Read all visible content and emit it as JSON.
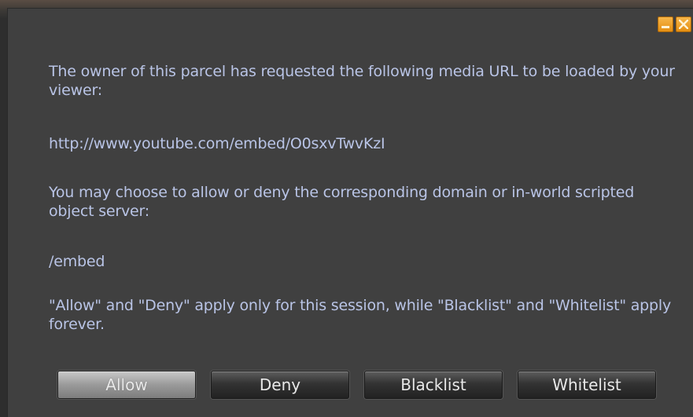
{
  "dialog": {
    "minimize_icon": "minimize-icon",
    "close_icon": "close-icon",
    "accent_color": "#e8951a",
    "text_color": "#b9c4e6",
    "message_intro": "The owner of this parcel has requested the following media URL to be loaded by your viewer:",
    "media_url": "http://www.youtube.com/embed/O0sxvTwvKzI",
    "choice_text": "You may choose to allow or deny the corresponding domain or in-world scripted object server:",
    "domain": "/embed",
    "note": "\"Allow\" and \"Deny\" apply only for this session, while \"Blacklist\" and \"Whitelist\" apply forever."
  },
  "buttons": {
    "allow": "Allow",
    "deny": "Deny",
    "blacklist": "Blacklist",
    "whitelist": "Whitelist"
  }
}
